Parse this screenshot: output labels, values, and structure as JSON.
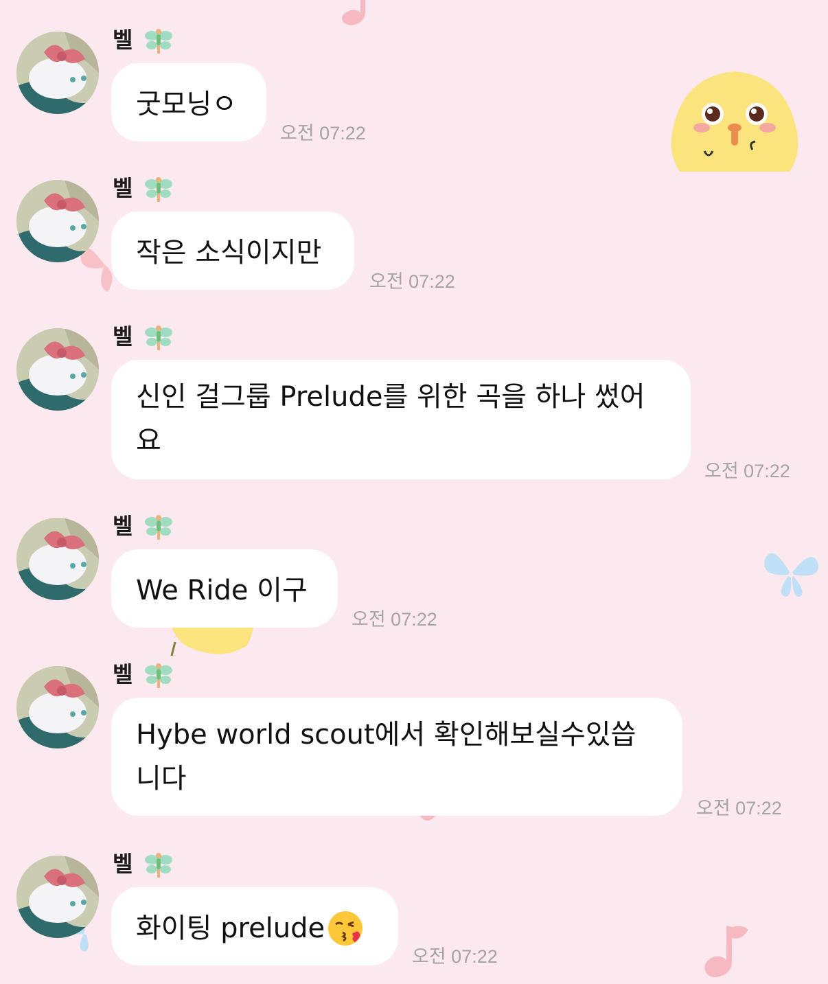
{
  "chat": {
    "sender_name": "벨",
    "messages": [
      {
        "text": "굿모닝ㅇ",
        "time": "오전 07:22"
      },
      {
        "text": "작은 소식이지만",
        "time": "오전 07:22"
      },
      {
        "text_line1": "신인 걸그룹 Prelude를 위한 곡을 하나 썼어",
        "text_line2": "요",
        "time": "오전 07:22"
      },
      {
        "text": "We Ride 이구",
        "time": "오전 07:22"
      },
      {
        "text_line1": "Hybe world scout에서 확인해보실수있씁",
        "text_line2": "니다",
        "time": "오전 07:22"
      },
      {
        "text": "화이팅 prelude",
        "time": "오전 07:22",
        "emoji": "kissing-face-with-heart-icon"
      }
    ]
  },
  "theme": {
    "background": "#fbe9ef",
    "bubble": "#ffffff",
    "timestamp": "#a6a3a5"
  }
}
